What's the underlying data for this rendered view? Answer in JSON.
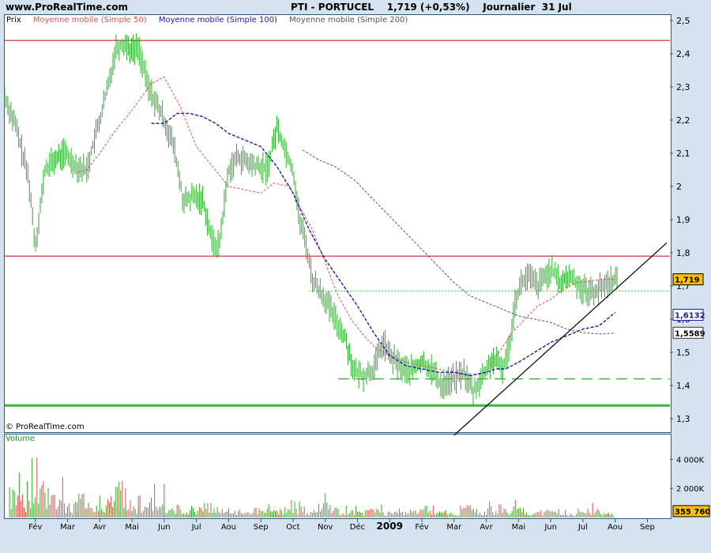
{
  "header": {
    "site": "www.ProRealTime.com",
    "title": "PTI - PORTUCEL    1,719 (+0,53%)    Journalier  31 Jul"
  },
  "legend": {
    "price": "Prix",
    "ma50": "Moyenne mobile (Simple 50)",
    "ma100": "Moyenne mobile (Simple 100)",
    "ma200": "Moyenne mobile (Simple 200)"
  },
  "copyright": "© ProRealTime.com",
  "volume_label": "Volume",
  "colors": {
    "price": "#2faa2f",
    "ma50": "#e05050",
    "ma100": "#1a1aa8",
    "ma200": "#555555",
    "resistance": "#cc2222",
    "support": "#33bb33",
    "dashed_support": "#33aa33",
    "last_price_badge": "#ffc000",
    "trendline": "#000000"
  },
  "chart_data": {
    "type": "line",
    "price_axis": {
      "ylim": [
        1.3,
        2.5
      ],
      "ticks": [
        "2,5",
        "2,4",
        "2,3",
        "2,2",
        "2,1",
        "2",
        "1,9",
        "1,8",
        "1,7",
        "1,6",
        "1,5",
        "1,4",
        "1,3"
      ],
      "tick_values": [
        2.5,
        2.4,
        2.3,
        2.2,
        2.1,
        2.0,
        1.9,
        1.8,
        1.7,
        1.6,
        1.5,
        1.4,
        1.3
      ]
    },
    "x_axis": {
      "labels": [
        "Fév",
        "Mar",
        "Avr",
        "Mai",
        "Jun",
        "Jul",
        "Aou",
        "Sep",
        "Oct",
        "Nov",
        "Déc",
        "2009",
        "Fév",
        "Mar",
        "Avr",
        "Mai",
        "Jun",
        "Jul",
        "Aou",
        "Sep"
      ],
      "bold_label": "2009",
      "month_index": [
        1,
        2,
        3,
        4,
        5,
        6,
        7,
        8,
        9,
        10,
        11,
        12,
        13,
        14,
        15,
        16,
        17,
        18,
        19,
        20
      ],
      "xlim": [
        0.05,
        20.7
      ]
    },
    "price": {
      "month_index": [
        0.05,
        0.4,
        0.8,
        1.0,
        1.3,
        1.6,
        1.9,
        2.3,
        2.6,
        2.8,
        3.0,
        3.3,
        3.5,
        3.8,
        4.0,
        4.2,
        4.5,
        4.8,
        5.0,
        5.3,
        5.6,
        5.9,
        6.2,
        6.5,
        6.7,
        7.0,
        7.3,
        7.6,
        7.9,
        8.2,
        8.5,
        8.8,
        9.0,
        9.2,
        9.4,
        9.6,
        9.8,
        10.0,
        10.3,
        10.6,
        10.9,
        11.2,
        11.5,
        11.8,
        12.0,
        12.3,
        12.6,
        13.0,
        13.3,
        13.6,
        14.0,
        14.3,
        14.6,
        14.9,
        15.2,
        15.5,
        15.7,
        15.9,
        16.1,
        16.3,
        16.6,
        17.0,
        17.3,
        17.6,
        17.9,
        18.2,
        18.5,
        18.9,
        19.1
      ],
      "close": [
        2.27,
        2.18,
        2.02,
        1.82,
        2.05,
        2.08,
        2.1,
        2.06,
        2.05,
        2.13,
        2.2,
        2.32,
        2.42,
        2.43,
        2.41,
        2.42,
        2.3,
        2.24,
        2.2,
        2.12,
        1.95,
        1.97,
        1.96,
        1.83,
        1.82,
        2.05,
        2.09,
        2.07,
        2.06,
        2.05,
        2.18,
        2.1,
        2.05,
        1.9,
        1.83,
        1.72,
        1.69,
        1.66,
        1.6,
        1.55,
        1.44,
        1.43,
        1.45,
        1.53,
        1.49,
        1.46,
        1.44,
        1.47,
        1.45,
        1.4,
        1.42,
        1.44,
        1.38,
        1.43,
        1.48,
        1.45,
        1.51,
        1.66,
        1.71,
        1.73,
        1.7,
        1.75,
        1.71,
        1.73,
        1.7,
        1.68,
        1.69,
        1.72,
        1.719
      ]
    },
    "series": [
      {
        "name": "Moyenne mobile (Simple 50)",
        "month_index": [
          2.2,
          2.6,
          3.0,
          3.5,
          4.0,
          4.6,
          5.0,
          5.5,
          6.0,
          6.5,
          7.0,
          7.5,
          8.0,
          8.4,
          8.9,
          9.2,
          9.6,
          10.0,
          10.4,
          10.8,
          11.2,
          11.6,
          12.0,
          12.5,
          13.0,
          13.5,
          14.0,
          14.5,
          15.0,
          15.4,
          15.8,
          16.2,
          16.6,
          17.0,
          17.4,
          17.8,
          18.2,
          18.6,
          19.0
        ],
        "values": [
          2.04,
          2.05,
          2.1,
          2.17,
          2.23,
          2.31,
          2.33,
          2.24,
          2.12,
          2.06,
          2.0,
          1.99,
          1.98,
          2.01,
          2.0,
          1.94,
          1.87,
          1.77,
          1.67,
          1.6,
          1.55,
          1.51,
          1.49,
          1.47,
          1.46,
          1.45,
          1.44,
          1.43,
          1.44,
          1.5,
          1.56,
          1.6,
          1.64,
          1.66,
          1.69,
          1.71,
          1.715,
          1.72,
          1.72
        ]
      },
      {
        "name": "Moyenne mobile (Simple 100)",
        "month_index": [
          4.6,
          5.0,
          5.4,
          5.8,
          6.2,
          6.6,
          7.0,
          7.5,
          8.0,
          8.5,
          9.0,
          9.5,
          10.0,
          10.5,
          11.0,
          11.5,
          12.0,
          12.5,
          13.0,
          13.5,
          14.0,
          14.5,
          15.0,
          15.3,
          15.6,
          16.0,
          16.5,
          17.0,
          17.5,
          18.0,
          18.5,
          19.0
        ],
        "values": [
          2.19,
          2.19,
          2.22,
          2.22,
          2.21,
          2.19,
          2.16,
          2.14,
          2.12,
          2.06,
          1.98,
          1.87,
          1.78,
          1.71,
          1.64,
          1.56,
          1.49,
          1.46,
          1.45,
          1.44,
          1.44,
          1.43,
          1.44,
          1.45,
          1.45,
          1.47,
          1.5,
          1.53,
          1.55,
          1.57,
          1.58,
          1.62
        ]
      },
      {
        "name": "Moyenne mobile (Simple 200)",
        "month_index": [
          9.3,
          9.8,
          10.3,
          10.9,
          11.5,
          12.0,
          12.5,
          13.0,
          13.5,
          14.0,
          14.5,
          15.0,
          15.5,
          16.0,
          16.5,
          17.0,
          17.5,
          18.0,
          18.5,
          19.0
        ],
        "values": [
          2.11,
          2.08,
          2.06,
          2.02,
          1.96,
          1.91,
          1.86,
          1.81,
          1.76,
          1.71,
          1.67,
          1.65,
          1.63,
          1.61,
          1.6,
          1.59,
          1.57,
          1.56,
          1.555,
          1.558
        ]
      }
    ],
    "horizontal_lines": [
      {
        "value": 2.44,
        "style": "resistance"
      },
      {
        "value": 1.79,
        "style": "resistance"
      },
      {
        "value": 1.685,
        "style": "dotted"
      },
      {
        "value": 1.42,
        "style": "dashed_support"
      },
      {
        "value": 1.34,
        "style": "support"
      }
    ],
    "trendline": {
      "from": [
        14.0,
        1.25
      ],
      "to": [
        20.6,
        1.83
      ]
    },
    "price_badges": [
      {
        "text": "1,719",
        "value": 1.72,
        "style": "last"
      },
      {
        "text": "1,6132",
        "value": 1.6132,
        "style": "ma100"
      },
      {
        "text": "1,5589",
        "value": 1.5589,
        "style": "ma200"
      }
    ],
    "volume": {
      "ylim": [
        0,
        5000
      ],
      "unit": "K",
      "ticks": [
        "4 000K",
        "2 000K"
      ],
      "tick_values": [
        4000,
        2000
      ],
      "month_index": [
        0.2,
        0.5,
        0.9,
        1.1,
        1.5,
        1.9,
        2.3,
        2.6,
        3.0,
        3.3,
        3.6,
        3.8,
        4.2,
        4.6,
        5.0,
        5.4,
        5.8,
        6.2,
        6.6,
        7.0,
        7.4,
        7.8,
        8.2,
        8.6,
        9.0,
        9.4,
        9.8,
        10.2,
        10.6,
        11.0,
        11.4,
        11.8,
        12.2,
        12.6,
        13.0,
        13.4,
        13.8,
        14.2,
        14.6,
        15.0,
        15.4,
        15.8,
        16.2,
        16.6,
        17.0,
        17.4,
        17.8,
        18.2,
        18.6,
        19.0
      ],
      "values": [
        3100,
        2500,
        4100,
        3600,
        2800,
        1600,
        2900,
        1500,
        1900,
        2100,
        4300,
        1200,
        1500,
        2300,
        1000,
        1300,
        1200,
        1000,
        1100,
        800,
        900,
        1000,
        900,
        1200,
        1100,
        800,
        1700,
        1000,
        800,
        900,
        900,
        700,
        600,
        900,
        800,
        800,
        600,
        1400,
        600,
        1100,
        900,
        1200,
        600,
        800,
        900,
        500,
        600,
        1000,
        600,
        355.76
      ],
      "last_badge": "355 760"
    }
  }
}
